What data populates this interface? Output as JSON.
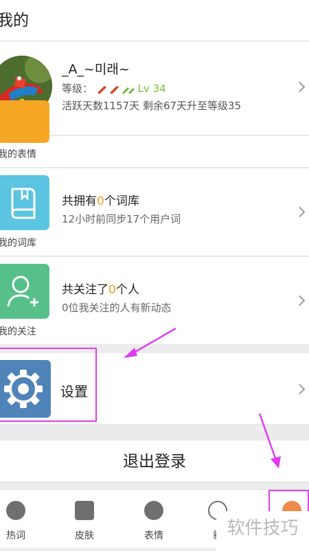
{
  "header": {
    "title": "我的"
  },
  "profile": {
    "name": "_A_~미래~",
    "level_label": "等级：",
    "level_value": "Lv 34",
    "active_text": "活跃天数1157天 剩余67天升至等级35"
  },
  "menu": {
    "emoji_label": "我的表情",
    "lexicon": {
      "label": "我的词库",
      "title_pre": "共拥有",
      "count": "0",
      "title_post": "个词库",
      "subtitle": "12小时前同步17个用户词"
    },
    "follow": {
      "label": "我的关注",
      "title_pre": "共关注了",
      "count": "0",
      "title_post": "个人",
      "subtitle": "0位我关注的人有新动态"
    },
    "settings_label": "设置"
  },
  "logout_label": "退出登录",
  "tabs": [
    {
      "label": "热词",
      "icon": "hot-icon"
    },
    {
      "label": "皮肤",
      "icon": "shirt-icon"
    },
    {
      "label": "表情",
      "icon": "emoji-icon"
    },
    {
      "label": "新",
      "icon": "new-icon"
    }
  ],
  "watermark": "软件技巧",
  "colors": {
    "accent_orange": "#f39a2b",
    "level_green": "#7bbd3b",
    "highlight": "#e03cf0",
    "settings_tile": "#5083b8",
    "lexicon_tile": "#5bc4e0",
    "follow_tile": "#57c08a"
  }
}
